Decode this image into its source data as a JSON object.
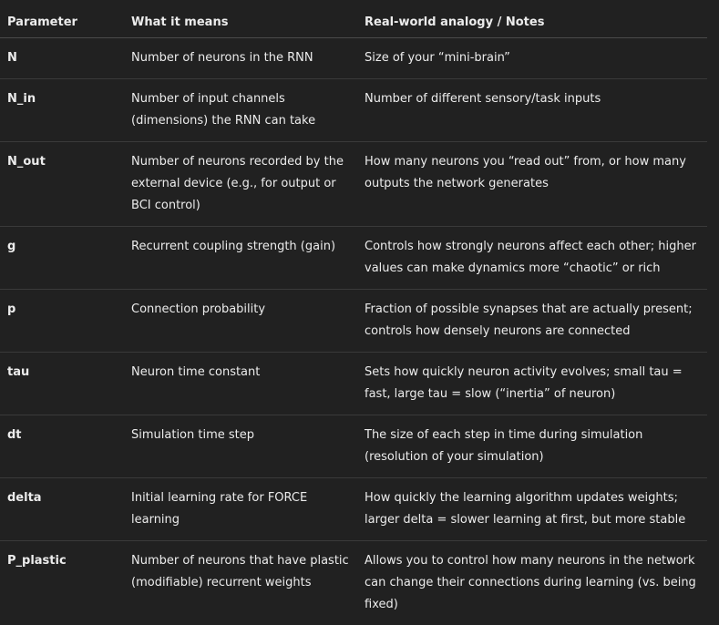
{
  "table": {
    "headers": [
      "Parameter",
      "What it means",
      "Real-world analogy / Notes"
    ],
    "rows": [
      {
        "param": "N",
        "meaning": "Number of neurons in the RNN",
        "notes": "Size of your “mini-brain”"
      },
      {
        "param": "N_in",
        "meaning": "Number of input channels (dimensions) the RNN can take",
        "notes": "Number of different sensory/task inputs"
      },
      {
        "param": "N_out",
        "meaning": "Number of neurons recorded by the external device (e.g., for output or BCI control)",
        "notes": "How many neurons you “read out” from, or how many outputs the network generates"
      },
      {
        "param": "g",
        "meaning": "Recurrent coupling strength (gain)",
        "notes": "Controls how strongly neurons affect each other; higher values can make dynamics more “chaotic” or rich"
      },
      {
        "param": "p",
        "meaning": "Connection probability",
        "notes": "Fraction of possible synapses that are actually present; controls how densely neurons are connected"
      },
      {
        "param": "tau",
        "meaning": "Neuron time constant",
        "notes": "Sets how quickly neuron activity evolves; small tau = fast, large tau = slow (“inertia” of neuron)"
      },
      {
        "param": "dt",
        "meaning": "Simulation time step",
        "notes": "The size of each step in time during simulation (resolution of your simulation)"
      },
      {
        "param": "delta",
        "meaning": "Initial learning rate for FORCE learning",
        "notes": "How quickly the learning algorithm updates weights; larger delta = slower learning at first, but more stable"
      },
      {
        "param": "P_plastic",
        "meaning": "Number of neurons that have plastic (modifiable) recurrent weights",
        "notes": "Allows you to control how many neurons in the network can change their connections during learning (vs. being fixed)"
      }
    ]
  }
}
